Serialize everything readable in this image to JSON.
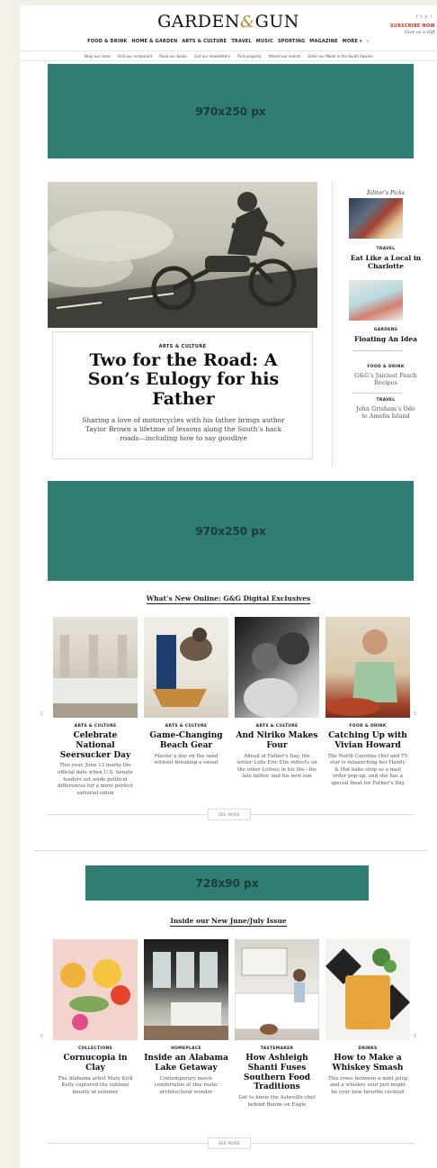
{
  "header": {
    "logo_left": "GARDEN",
    "logo_amp": "&",
    "logo_right": "GUN",
    "social_icons": [
      "facebook-icon",
      "twitter-icon",
      "pinterest-icon",
      "instagram-icon"
    ],
    "social_glyphs": [
      "f",
      "t",
      "p",
      "i"
    ],
    "subscribe": "SUBSCRIBE NOW",
    "gift": "Give as a Gift",
    "nav": [
      "FOOD & DRINK",
      "HOME & GARDEN",
      "ARTS & CULTURE",
      "TRAVEL",
      "MUSIC",
      "SPORTING",
      "MAGAZINE",
      "MORE ▾"
    ],
    "search_glyph": "⌕",
    "subnav": [
      "Shop our store",
      "Visit our restaurant",
      "Read our books",
      "Get our newsletters",
      "Find property",
      "Attend our events",
      "Enter our Made in the South Awards"
    ]
  },
  "ads": {
    "top": "970x250 px",
    "middle": "970x250 px",
    "leader": "728x90 px"
  },
  "hero": {
    "kicker": "ARTS & CULTURE",
    "title": "Two for the Road: A Son’s Eulogy for his Father",
    "dek": "Sharing a love of motorcycles with his father brings author Taylor Brown a lifetime of lessons along the South’s back roads—including how to say goodbye"
  },
  "editors_picks": {
    "heading": "Editor’s Picks",
    "items": [
      {
        "kicker": "TRAVEL",
        "title": "Eat Like a Local in Charlotte"
      },
      {
        "kicker": "GARDENS",
        "title": "Floating An Idea"
      },
      {
        "kicker": "FOOD & DRINK",
        "title": "G&G’s Juiciest Peach Recipes"
      },
      {
        "kicker": "TRAVEL",
        "title": "John Grisham’s Ode to Amelia Island"
      }
    ]
  },
  "digital": {
    "heading": "What’s New Online: G&G Digital Exclusives",
    "cards": [
      {
        "kicker": "ARTS & CULTURE",
        "title": "Celebrate National Seersucker Day",
        "dek": "This year, June 13 marks the official date when U.S. Senate leaders set aside political differences for a more perfect sartorial union"
      },
      {
        "kicker": "ARTS & CULTURE",
        "title": "Game-Changing Beach Gear",
        "dek": "Master a day on the sand without breaking a sweat"
      },
      {
        "kicker": "ARTS & CULTURE",
        "title": "And Niriko Makes Four",
        "dek": "Ahead of Father’s Day, the writer Lolis Eric Elie reflects on the other Lolises in his life—his late father, and his new son"
      },
      {
        "kicker": "FOOD & DRINK",
        "title": "Catching Up with Vivian Howard",
        "dek": "The North Carolina chef and TV star is relaunching her Handy & Hot bake shop as a mail order pop-up, and she has a special treat for Father’s Day"
      }
    ],
    "see_more": "SEE MORE"
  },
  "issue": {
    "heading": "Inside our New June/July Issue",
    "cards": [
      {
        "kicker": "COLLECTIONS",
        "title": "Cornucopia in Clay",
        "dek": "The Alabama artist Mary Kirk Kelly captured the sublime bounty of summer"
      },
      {
        "kicker": "HOMEPLACE",
        "title": "Inside an Alabama Lake Getaway",
        "dek": "Contemporary meets comfortable at this rustic architectural wonder"
      },
      {
        "kicker": "TASTEMAKER",
        "title": "How Ashleigh Shanti Fuses Southern Food Traditions",
        "dek": "Get to know the Asheville chef behind Benne on Eagle"
      },
      {
        "kicker": "DRINKS",
        "title": "How to Make a Whiskey Smash",
        "dek": "This cross between a mint julep and a whiskey sour just might be your new favorite cocktail"
      }
    ],
    "see_more": "SEE MORE"
  },
  "arrows": {
    "left": "‹",
    "right": "›"
  },
  "colors": {
    "ad": "#2f7d73",
    "subscribe": "#c0392b",
    "accent": "#b8862e"
  }
}
